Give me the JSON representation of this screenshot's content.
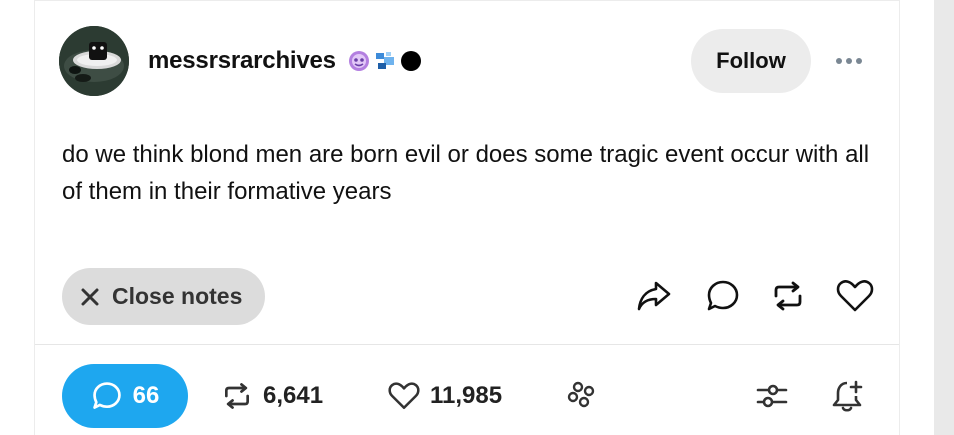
{
  "post": {
    "username": "messrsrarchives",
    "follow_label": "Follow",
    "text": "do we think blond men are born evil or does some tragic event occur with all of them in their formative years",
    "close_notes_label": "Close notes"
  },
  "badges": [
    "purple-badge-icon",
    "blue-badge-icon",
    "black-dot-icon"
  ],
  "footer": {
    "replies": "66",
    "reblogs": "6,641",
    "likes": "11,985"
  },
  "colors": {
    "reply_pill": "#1ea7ef",
    "follow_bg": "#ececec",
    "close_notes_bg": "#dcdcdc",
    "purple_badge": "#b37fe0",
    "blue_badge": "#3d8bd9"
  }
}
